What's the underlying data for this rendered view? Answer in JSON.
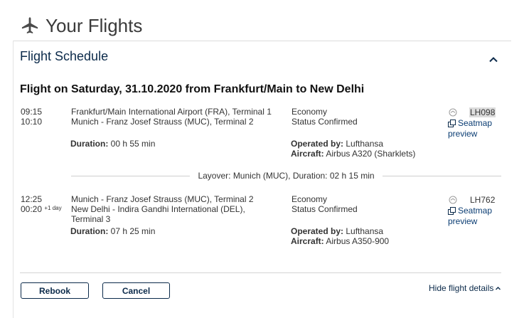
{
  "page": {
    "title": "Your Flights"
  },
  "schedule": {
    "title": "Flight Schedule"
  },
  "trip": {
    "title": "Flight on Saturday, 31.10.2020 from Frankfurt/Main to New Delhi"
  },
  "segments": [
    {
      "dep_time": "09:15",
      "arr_time": "10:10",
      "arr_day_offset": "",
      "from": "Frankfurt/Main International Airport (FRA), Terminal 1",
      "to": "Munich - Franz Josef Strauss (MUC), Terminal 2",
      "to_line2": "",
      "duration_label": "Duration:",
      "duration": "00 h 55 min",
      "cabin": "Economy",
      "status": "Status Confirmed",
      "operated_label": "Operated by:",
      "operator": "Lufthansa",
      "aircraft_label": "Aircraft:",
      "aircraft": "Airbus A320 (Sharklets)",
      "flight_no": "LH098",
      "seatmap_line1": "Seatmap",
      "seatmap_line2": "preview"
    },
    {
      "dep_time": "12:25",
      "arr_time": "00:20",
      "arr_day_offset": "+1 day",
      "from": "Munich - Franz Josef Strauss (MUC), Terminal 2",
      "to": "New Delhi - Indira Gandhi International (DEL),",
      "to_line2": "Terminal 3",
      "duration_label": "Duration:",
      "duration": "07 h 25 min",
      "cabin": "Economy",
      "status": "Status Confirmed",
      "operated_label": "Operated by:",
      "operator": "Lufthansa",
      "aircraft_label": "Aircraft:",
      "aircraft": "Airbus A350-900",
      "flight_no": "LH762",
      "seatmap_line1": "Seatmap",
      "seatmap_line2": "preview"
    }
  ],
  "layover": {
    "text": "Layover: Munich (MUC), Duration: 02 h 15 min"
  },
  "actions": {
    "rebook": "Rebook",
    "cancel": "Cancel",
    "hide_details": "Hide flight details"
  },
  "icons": {
    "page": "airplane-icon",
    "collapse": "chevron-up-icon",
    "status": "flight-status-icon",
    "seatmap": "external-window-icon"
  },
  "colors": {
    "accent": "#0b2a4a",
    "highlight": "#dcdcdc"
  }
}
